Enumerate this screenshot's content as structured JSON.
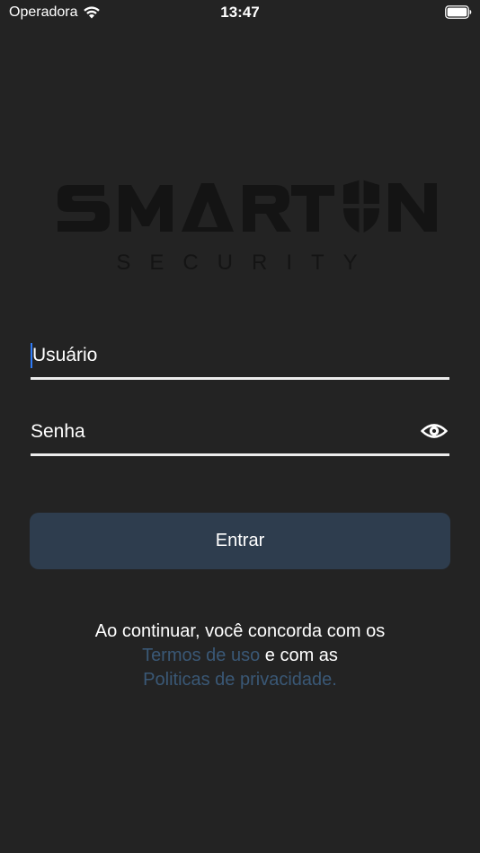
{
  "status_bar": {
    "carrier": "Operadora",
    "time": "13:47",
    "wifi_icon": "wifi-icon",
    "battery_icon": "battery-icon"
  },
  "logo": {
    "brand": "SMARTON",
    "subtitle": "SECURITY",
    "color": "#141414"
  },
  "form": {
    "username_placeholder": "Usuário",
    "password_placeholder": "Senha",
    "eye_icon": "eye-icon",
    "submit_label": "Entrar"
  },
  "terms": {
    "line1": "Ao continuar, você concorda com os",
    "terms_link": "Termos de uso",
    "middle": " e com as",
    "privacy_link": "Politicas de privacidade."
  },
  "colors": {
    "background": "#232323",
    "button": "#2e3d4e",
    "link": "#3a5876",
    "cursor": "#2f7bf7"
  }
}
